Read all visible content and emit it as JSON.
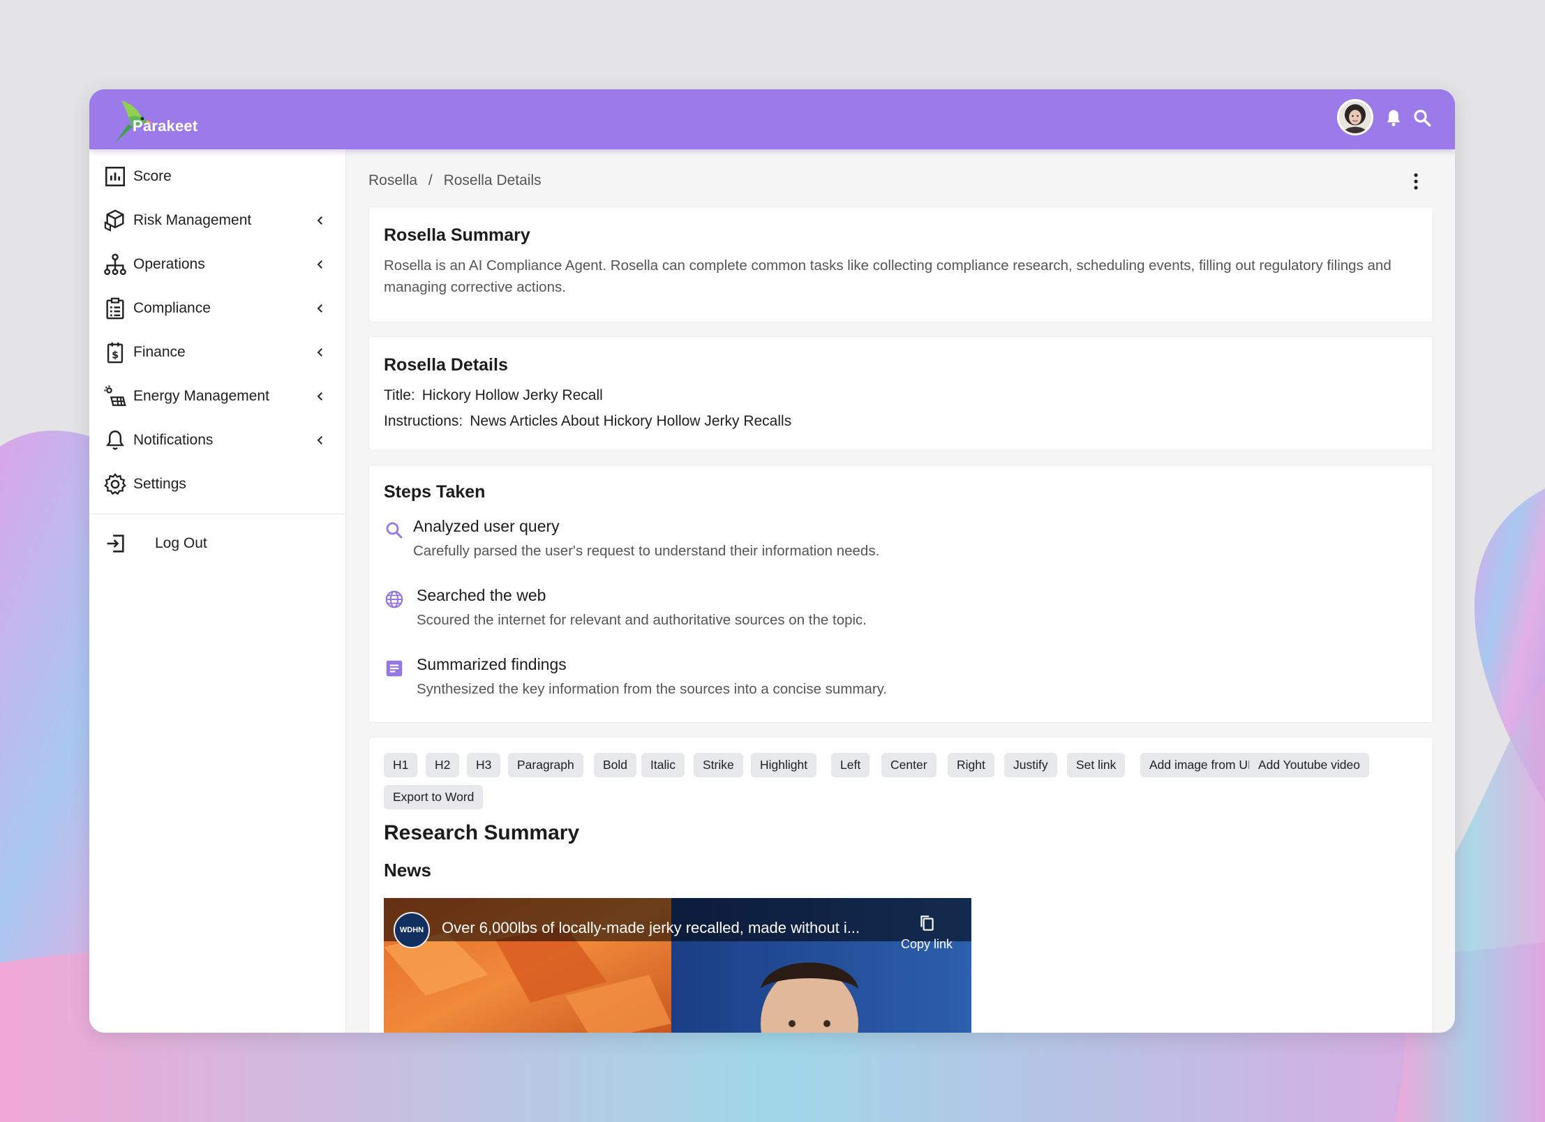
{
  "app": {
    "name": "Parakeet"
  },
  "colors": {
    "brand": "#9b7bea",
    "accent_icon": "#9477e0"
  },
  "sidebar": {
    "items": [
      {
        "label": "Score",
        "icon": "bar-chart-icon",
        "expandable": false
      },
      {
        "label": "Risk Management",
        "icon": "cubes-icon",
        "expandable": true
      },
      {
        "label": "Operations",
        "icon": "hierarchy-icon",
        "expandable": true
      },
      {
        "label": "Compliance",
        "icon": "clipboard-list-icon",
        "expandable": true
      },
      {
        "label": "Finance",
        "icon": "dollar-calendar-icon",
        "expandable": true
      },
      {
        "label": "Energy Management",
        "icon": "solar-panel-icon",
        "expandable": true
      },
      {
        "label": "Notifications",
        "icon": "bell-icon",
        "expandable": true
      },
      {
        "label": "Settings",
        "icon": "gear-icon",
        "expandable": false
      }
    ],
    "logout_label": "Log Out"
  },
  "breadcrumb": {
    "root": "Rosella",
    "separator": "/",
    "current": "Rosella Details"
  },
  "summary": {
    "title": "Rosella Summary",
    "text": "Rosella is an AI Compliance Agent. Rosella can complete common tasks like collecting compliance research, scheduling events, filling out regulatory filings and managing corrective actions."
  },
  "details": {
    "title": "Rosella Details",
    "title_key": "Title:",
    "title_value": "Hickory Hollow Jerky Recall",
    "instructions_key": "Instructions:",
    "instructions_value": "News Articles About Hickory Hollow Jerky Recalls"
  },
  "steps": {
    "title": "Steps Taken",
    "items": [
      {
        "title": "Analyzed user query",
        "desc": "Carefully parsed the user's request to understand their information needs.",
        "icon": "search-icon"
      },
      {
        "title": "Searched the web",
        "desc": "Scoured the internet for relevant and authoritative sources on the topic.",
        "icon": "globe-icon"
      },
      {
        "title": "Summarized findings",
        "desc": "Synthesized the key information from the sources into a concise summary.",
        "icon": "document-icon"
      }
    ]
  },
  "editor": {
    "toolbar": [
      "H1",
      "H2",
      "H3",
      "Paragraph",
      "Bold",
      "Italic",
      "Strike",
      "Highlight",
      "Left",
      "Center",
      "Right",
      "Justify",
      "Set link",
      "Add image from URL",
      "Add Youtube video",
      "Export to Word"
    ],
    "heading": "Research Summary",
    "subheading": "News",
    "video": {
      "title": "Over 6,000lbs of locally-made jerky recalled, made without i...",
      "channel": "WDHN",
      "copy_link_label": "Copy link"
    }
  }
}
